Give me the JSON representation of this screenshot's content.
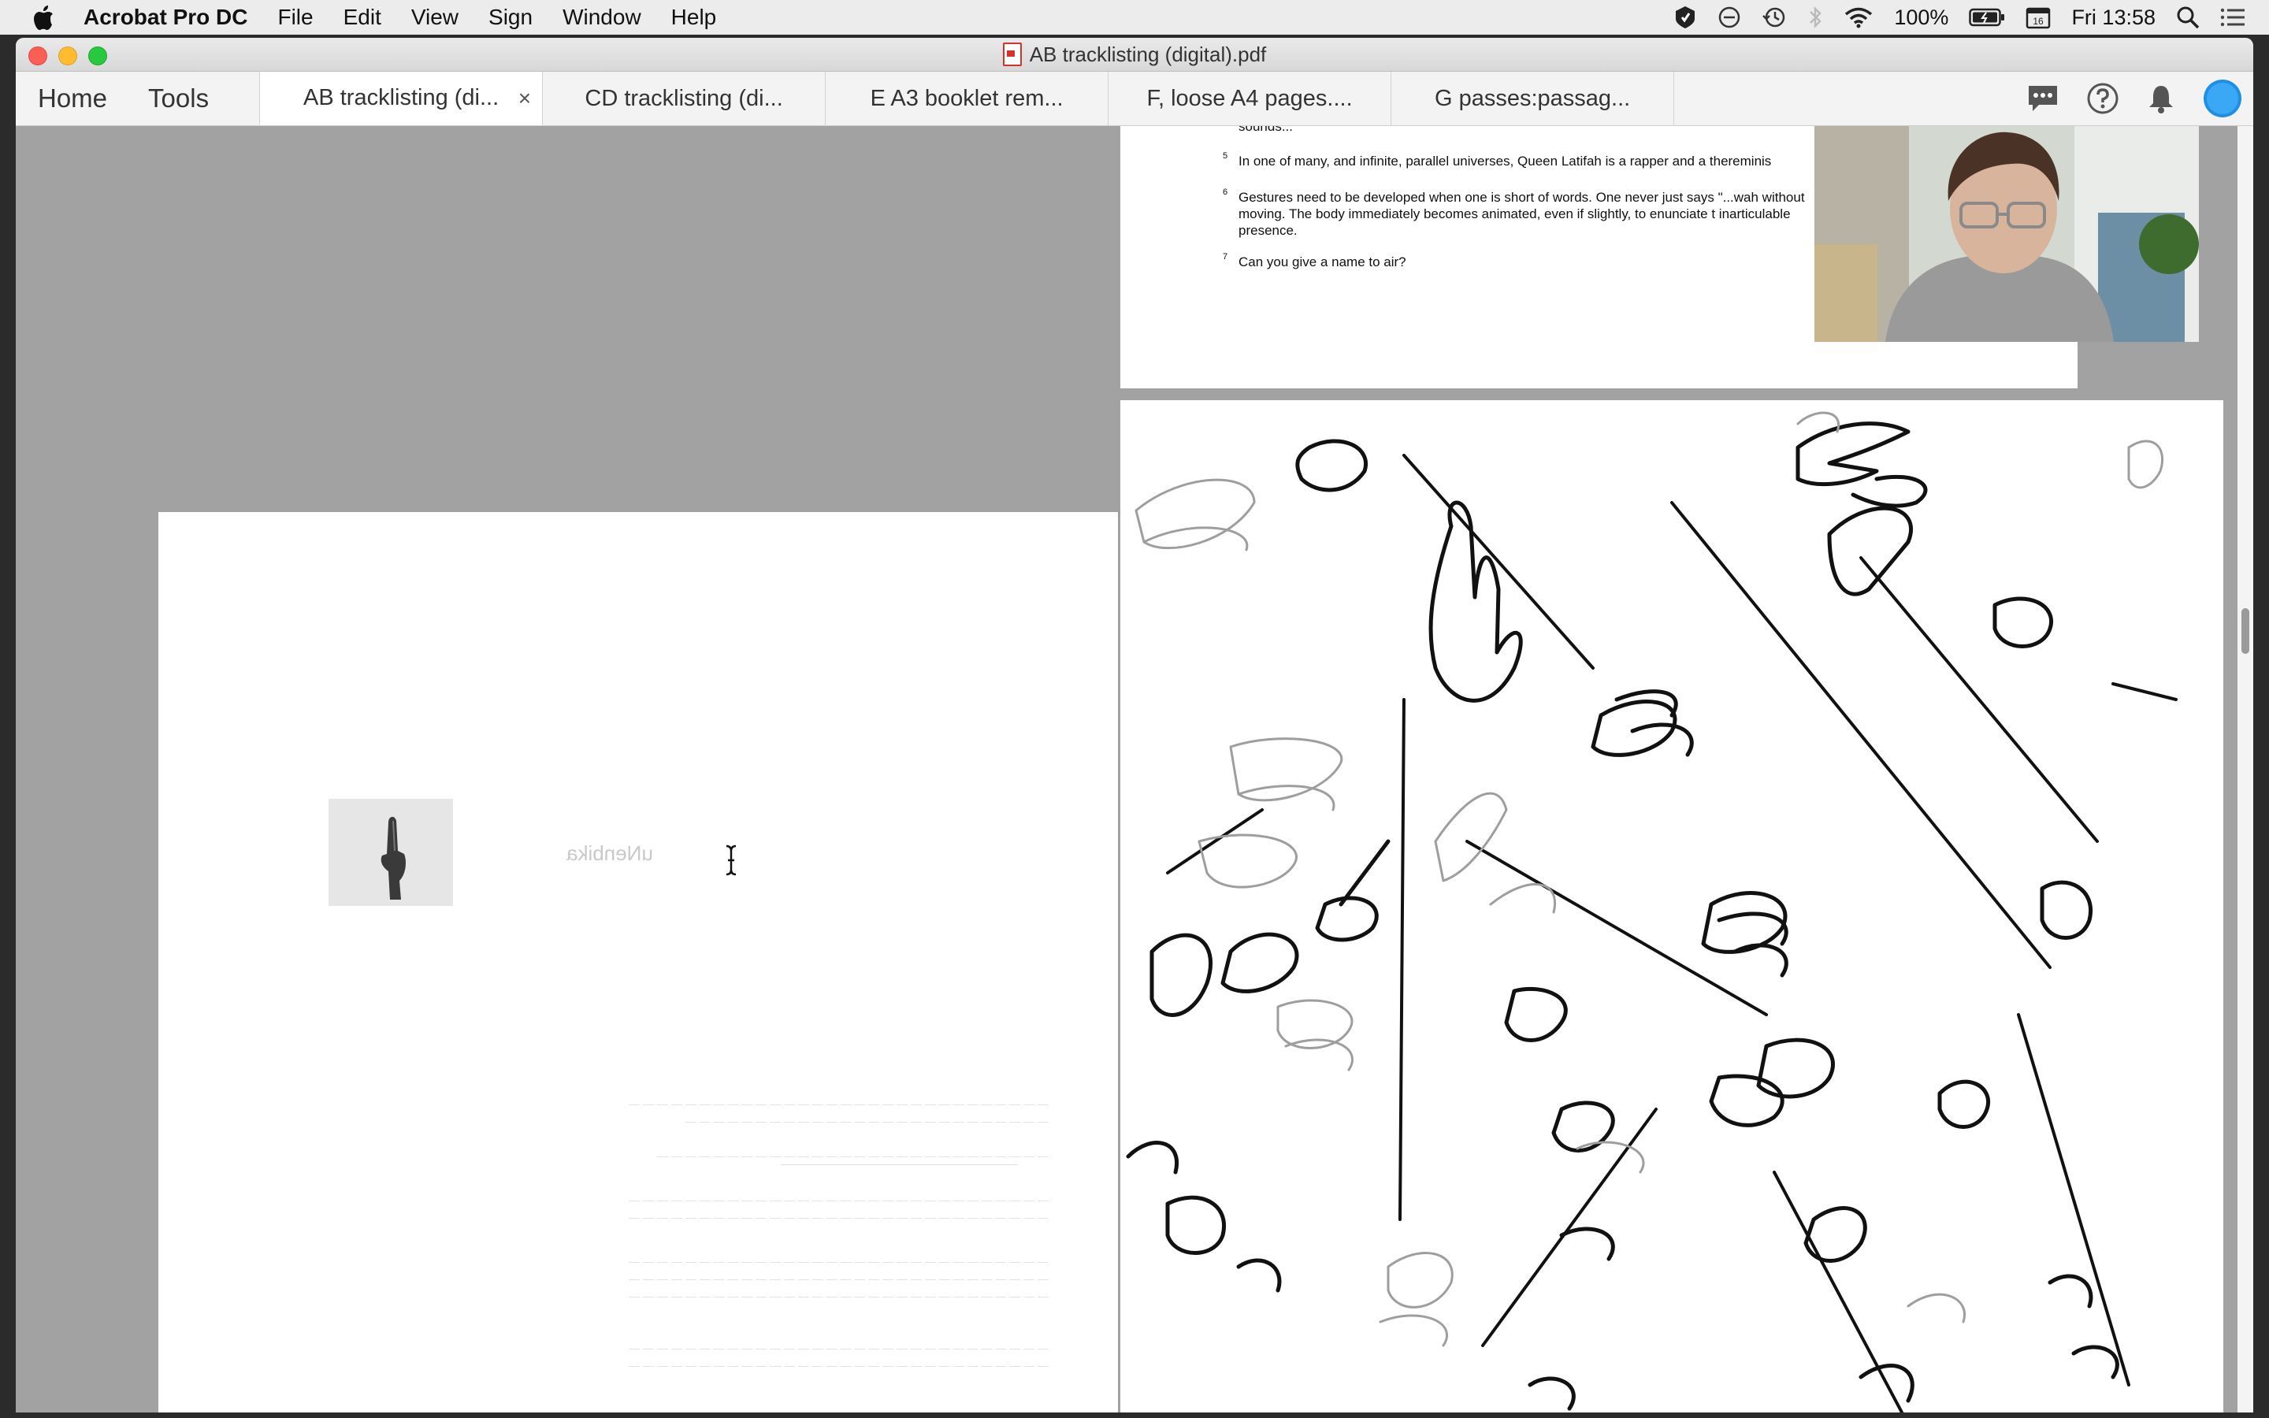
{
  "menubar": {
    "app_name": "Acrobat Pro DC",
    "items": [
      "File",
      "Edit",
      "View",
      "Sign",
      "Window",
      "Help"
    ],
    "battery": "100%",
    "clock": "Fri 13:58"
  },
  "window": {
    "title": "AB tracklisting (digital).pdf"
  },
  "toolbar": {
    "home": "Home",
    "tools": "Tools",
    "tabs": [
      {
        "label": "AB tracklisting (di...",
        "active": true
      },
      {
        "label": "CD tracklisting (di...",
        "active": false
      },
      {
        "label": "E A3 booklet rem...",
        "active": false
      },
      {
        "label": "F, loose A4 pages....",
        "active": false
      },
      {
        "label": "G passes:passag...",
        "active": false
      }
    ],
    "close_glyph": "×"
  },
  "document": {
    "top_page": {
      "fragment": "sounds...",
      "footnotes": [
        {
          "num": "5",
          "text": "In one of many, and infinite, parallel universes, Queen Latifah is a rapper and a thereminis"
        },
        {
          "num": "6",
          "text": "Gestures need to be developed when one is short of words. One never just says \"...wah without moving. The body immediately becomes animated, even if slightly, to enunciate t inarticulable presence."
        },
        {
          "num": "7",
          "text": "Can you give a name to air?"
        }
      ]
    },
    "left_page": {
      "mirrored_word": "uNenbika"
    }
  },
  "colors": {
    "accent": "#1f8fe6",
    "pdf_red": "#d8302b"
  },
  "icons": [
    "apple-icon",
    "shield-icon",
    "moon-icon",
    "time-machine-icon",
    "bluetooth-icon",
    "wifi-icon",
    "battery-icon",
    "calendar-icon",
    "search-icon",
    "list-icon",
    "comment-icon",
    "help-icon",
    "bell-icon",
    "profile-icon"
  ]
}
